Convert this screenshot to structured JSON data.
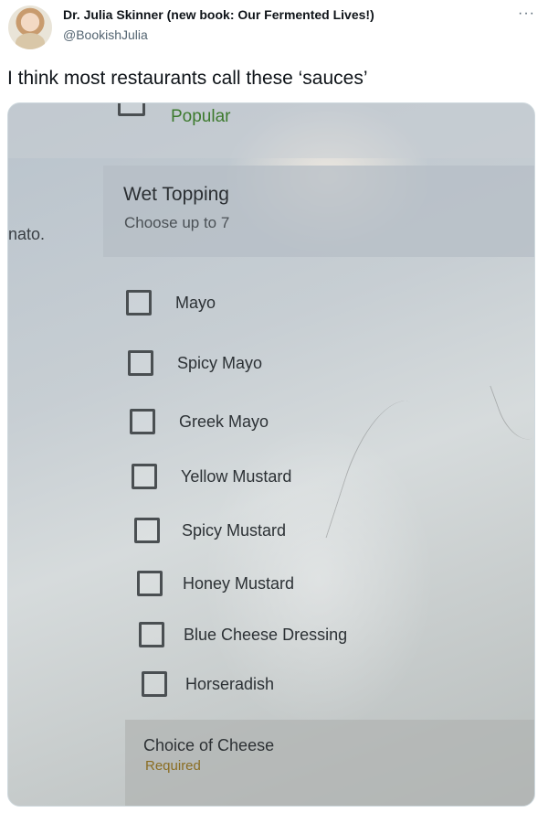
{
  "tweet": {
    "display_name": "Dr. Julia Skinner (new book: Our Fermented Lives!)",
    "handle": "@BookishJulia",
    "more_icon": "···",
    "text": "I think most restaurants call these ‘sauces’"
  },
  "photo": {
    "top_label": "Popular",
    "side_text": "nato.",
    "section": {
      "title": "Wet Topping",
      "subtitle": "Choose up to 7"
    },
    "options": [
      "Mayo",
      "Spicy Mayo",
      "Greek Mayo",
      "Yellow Mustard",
      "Spicy Mustard",
      "Honey Mustard",
      "Blue Cheese Dressing",
      "Horseradish"
    ],
    "next_section": {
      "title": "Choice of Cheese",
      "status": "Required"
    }
  },
  "colors": {
    "popular": "#3d7a2e",
    "required": "#8a6d22"
  }
}
